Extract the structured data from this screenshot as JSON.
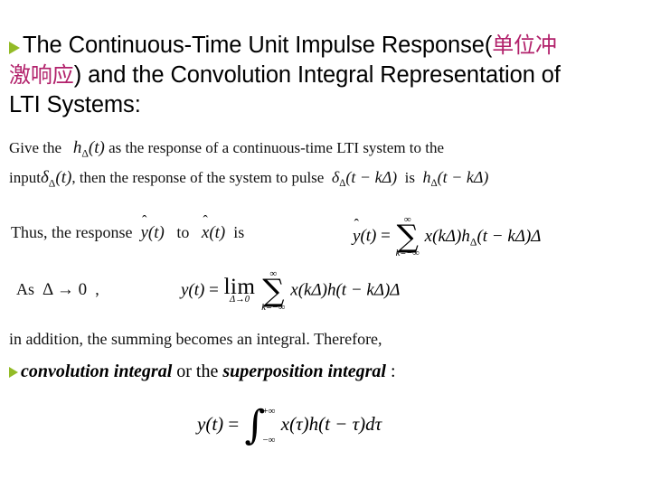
{
  "slide": {
    "background_color": "#ffffff",
    "bullet_color": "#93bb27",
    "chinese_text_color": "#b2216b"
  },
  "title": {
    "bullet_icon": "green-arrow-bullet",
    "part1": "The Continuous-Time Unit Impulse Response(",
    "chinese1": "单位冲",
    "chinese2": "激响应",
    "part2": ") and the Convolution Integral Representation of",
    "part3": "LTI Systems:"
  },
  "body": {
    "give_prefix": "Give the",
    "give_math": "hΔ(t)",
    "give_suffix": "as the response of a continuous-time LTI system to the",
    "input_prefix": "input",
    "input_math": "δΔ(t)",
    "input_mid": ", then the response of the system to pulse",
    "input_math2": "δΔ(t − kΔ)",
    "input_is": "is",
    "input_math3": "hΔ(t − kΔ)",
    "thus_prefix": "Thus, the response",
    "thus_math1": "ŷ(t)",
    "thus_to": "to",
    "thus_math2": "x̂(t)",
    "thus_is": "is",
    "as_prefix": "As",
    "as_math": "Δ → 0",
    "as_comma": ",",
    "addition": "in addition, the summing becomes an integral. Therefore,",
    "conv_bullet_icon": "green-arrow-bullet",
    "conv_term1": "convolution integral",
    "conv_mid": "or the",
    "conv_term2": "superposition integral",
    "conv_colon": ":"
  },
  "equations": {
    "thus": {
      "lhs": "ŷ(t)",
      "eq": "=",
      "sum_top": "∞",
      "sum_glyph": "∑",
      "sum_bottom": "k=−∞",
      "rhs": "x(kΔ)hΔ(t − kΔ)Δ"
    },
    "as": {
      "lhs": "y(t)",
      "eq": "=",
      "lim_word": "lim",
      "lim_bottom": "Δ→0",
      "sum_top": "∞",
      "sum_glyph": "∑",
      "sum_bottom": "k=−∞",
      "rhs": "x(kΔ)h(t − kΔ)Δ"
    },
    "final": {
      "lhs": "y(t)",
      "eq": "=",
      "int_glyph": "∫",
      "int_upper": "+∞",
      "int_lower": "−∞",
      "rhs": "x(τ)h(t − τ)dτ"
    }
  }
}
